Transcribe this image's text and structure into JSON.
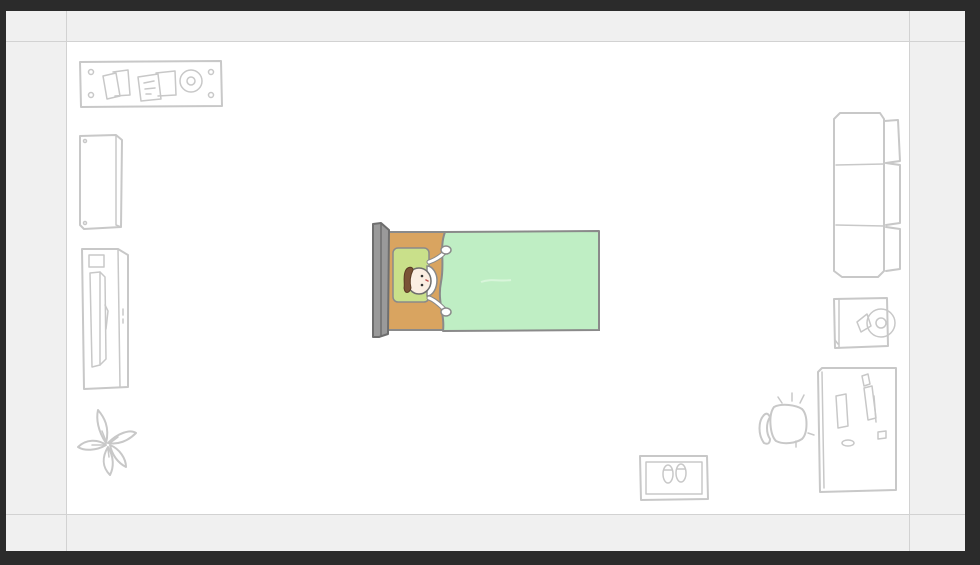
{
  "scene": {
    "name": "bedroom-top-down",
    "colors": {
      "background": "#2b2b2b",
      "wall": "#f0f0f0",
      "floor": "#ffffff",
      "sketch_line": "#c8c8c8",
      "bed_frame": "#8a8a8a",
      "bed_mattress": "#d9a460",
      "blanket": "#bfeec4",
      "pillow": "#c9e08a"
    },
    "objects": [
      {
        "id": "shelf-cd-books",
        "icon": "media-shelf-icon"
      },
      {
        "id": "dresser",
        "icon": "dresser-icon"
      },
      {
        "id": "wardrobe",
        "icon": "wardrobe-icon"
      },
      {
        "id": "potted-plant",
        "icon": "plant-icon"
      },
      {
        "id": "bed-with-sleeper",
        "icon": "bed-icon"
      },
      {
        "id": "sofa",
        "icon": "sofa-icon"
      },
      {
        "id": "nightstand-lamp",
        "icon": "nightstand-icon"
      },
      {
        "id": "desk",
        "icon": "desk-icon"
      },
      {
        "id": "desk-chair",
        "icon": "chair-icon"
      },
      {
        "id": "doormat-slippers",
        "icon": "slippers-icon"
      }
    ]
  }
}
